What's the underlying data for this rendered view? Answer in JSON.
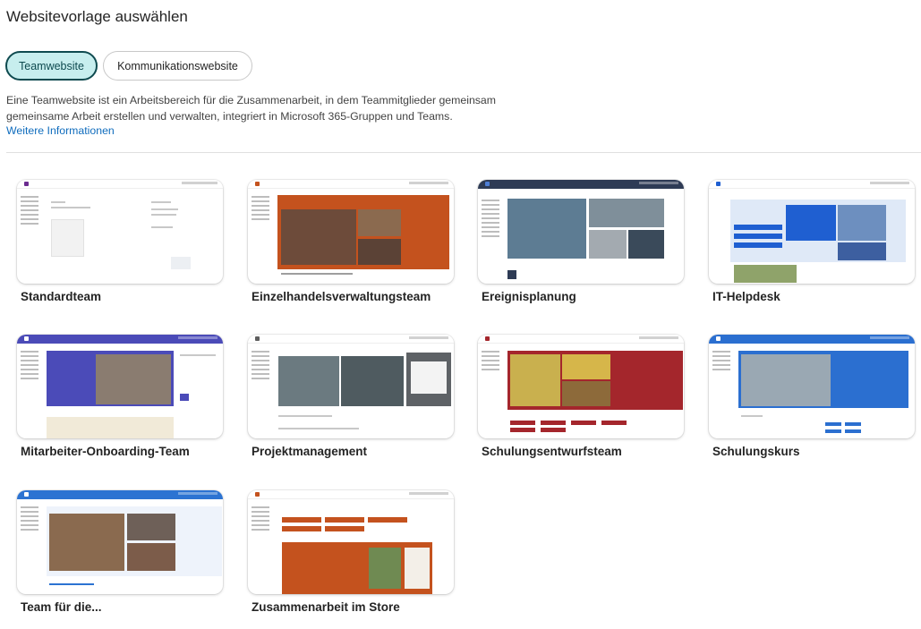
{
  "dialog": {
    "title": "Websitevorlage auswählen",
    "tabs": [
      {
        "label": "Teamwebsite",
        "selected": true
      },
      {
        "label": "Kommunikationswebsite",
        "selected": false
      }
    ],
    "description": "Eine Teamwebsite ist ein Arbeitsbereich für die Zusammenarbeit, in dem Teammitglieder gemeinsam gemeinsame Arbeit erstellen und verwalten, integriert in Microsoft 365-Gruppen und Teams.",
    "more_link": "Weitere Informationen"
  },
  "templates": [
    {
      "label": "Standardteam",
      "accent": "#6b2b8f"
    },
    {
      "label": "Einzelhandelsverwaltungsteam",
      "accent": "#c4521e"
    },
    {
      "label": "Ereignisplanung",
      "accent": "#2e3b55"
    },
    {
      "label": "IT-Helpdesk",
      "accent": "#1f5fd1"
    },
    {
      "label": "Mitarbeiter-Onboarding-Team",
      "accent": "#4b4bb8"
    },
    {
      "label": "Projektmanagement",
      "accent": "#5e5e5e"
    },
    {
      "label": "Schulungsentwurfsteam",
      "accent": "#a4262c"
    },
    {
      "label": "Schulungskurs",
      "accent": "#2b6fd0"
    },
    {
      "label": "Team für die...",
      "accent": "#2c73d2"
    },
    {
      "label": "Zusammenarbeit im Store",
      "accent": "#c4521e"
    }
  ]
}
